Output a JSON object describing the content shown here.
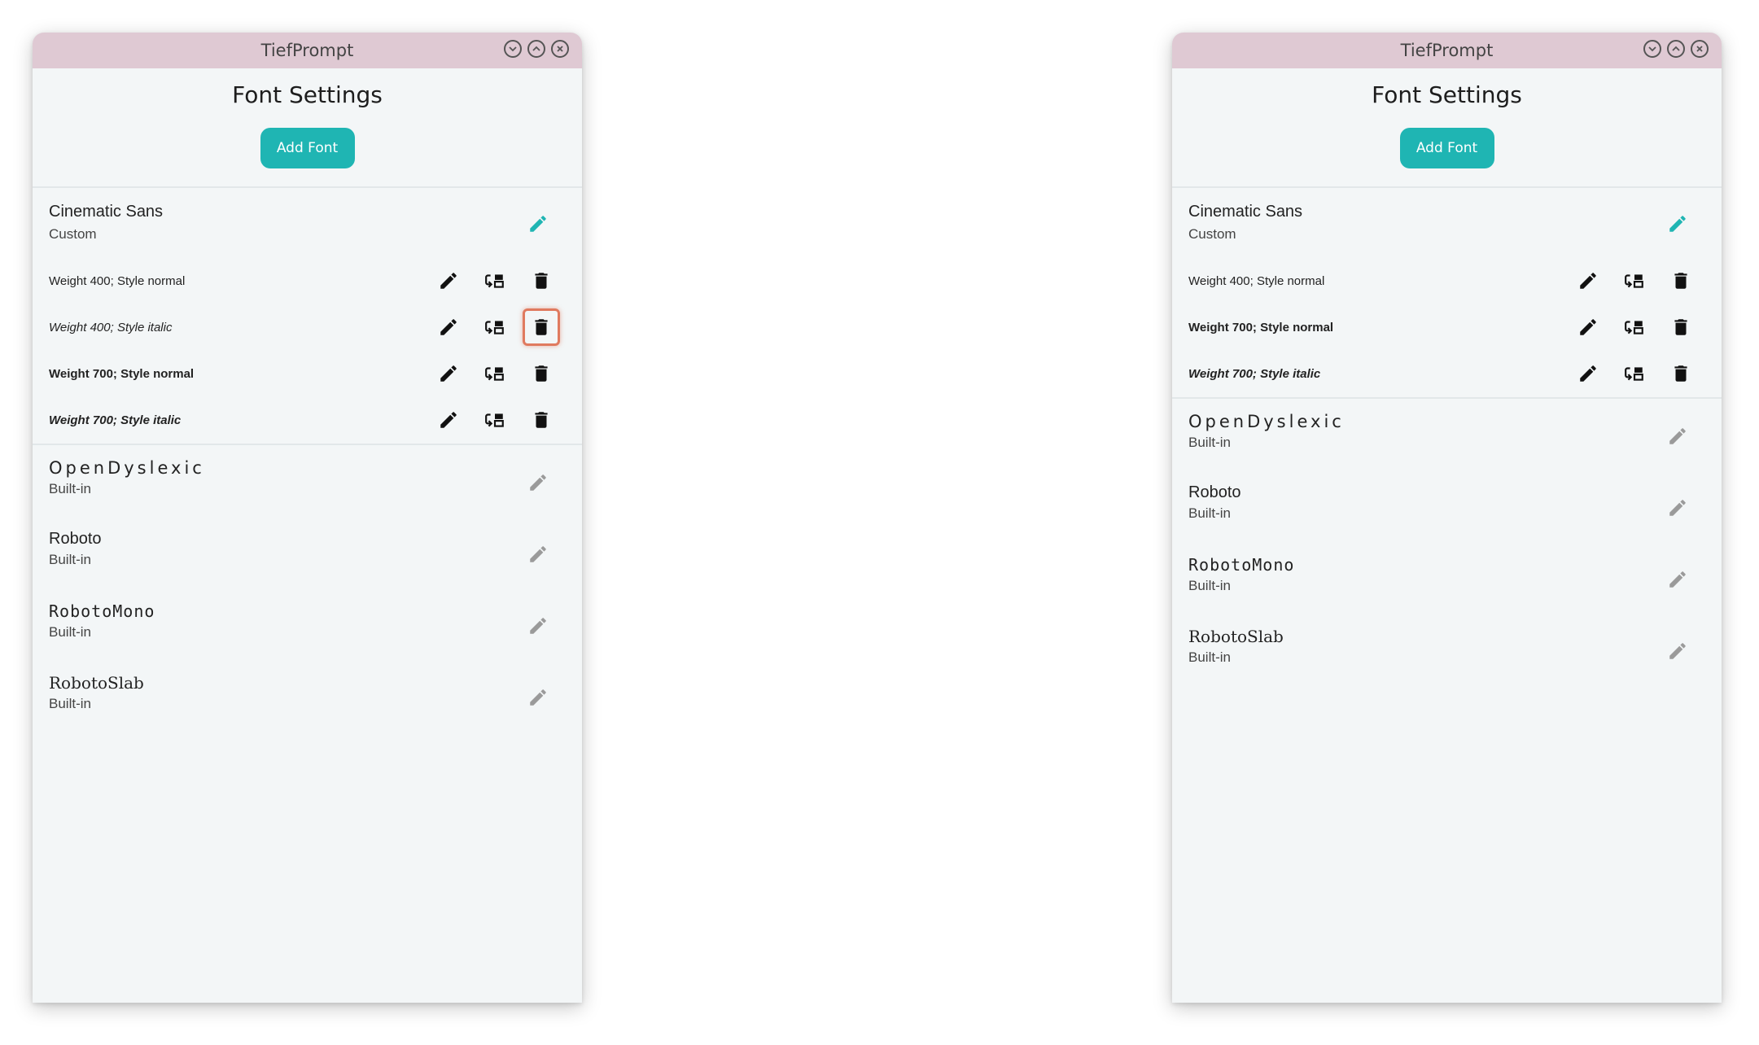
{
  "windows": [
    {
      "title": "TiefPrompt",
      "heading": "Font Settings",
      "add_font_label": "Add Font",
      "custom_font": {
        "name": "Cinematic Sans",
        "type": "Custom",
        "variants": [
          {
            "label": "Weight 400; Style normal"
          },
          {
            "label": "Weight 400; Style italic"
          },
          {
            "label": "Weight 700; Style normal"
          },
          {
            "label": "Weight 700; Style italic"
          }
        ]
      },
      "builtin_fonts": [
        {
          "name": "OpenDyslexic",
          "type": "Built-in"
        },
        {
          "name": "Roboto",
          "type": "Built-in"
        },
        {
          "name": "RobotoMono",
          "type": "Built-in"
        },
        {
          "name": "RobotoSlab",
          "type": "Built-in"
        }
      ]
    },
    {
      "title": "TiefPrompt",
      "heading": "Font Settings",
      "add_font_label": "Add Font",
      "custom_font": {
        "name": "Cinematic Sans",
        "type": "Custom",
        "variants": [
          {
            "label": "Weight 400; Style normal"
          },
          {
            "label": "Weight 700; Style normal"
          },
          {
            "label": "Weight 700; Style italic"
          }
        ]
      },
      "builtin_fonts": [
        {
          "name": "OpenDyslexic",
          "type": "Built-in"
        },
        {
          "name": "Roboto",
          "type": "Built-in"
        },
        {
          "name": "RobotoMono",
          "type": "Built-in"
        },
        {
          "name": "RobotoSlab",
          "type": "Built-in"
        }
      ]
    }
  ],
  "icons": {
    "edit": "pencil-icon",
    "replace": "replace-file-icon",
    "delete": "trash-icon",
    "minimize": "chevron-down-icon",
    "maximize": "chevron-up-icon",
    "close": "close-icon"
  },
  "colors": {
    "accent": "#1fb5b3",
    "titlebar": "#dfc9d3",
    "highlight": "#e07a5f",
    "background": "#f3f6f7"
  }
}
